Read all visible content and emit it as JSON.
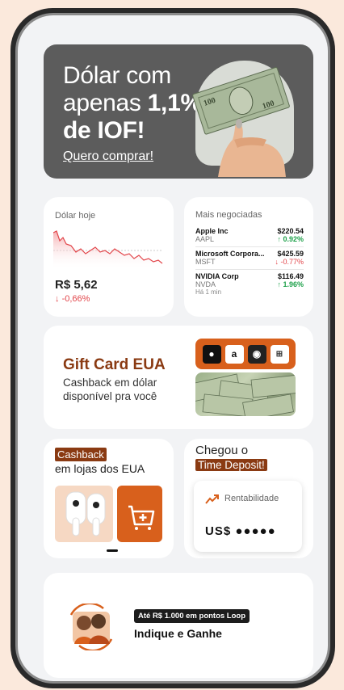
{
  "banner": {
    "line1": "Dólar com",
    "line2_prefix": "apenas ",
    "line2_bold": "1,1%",
    "line3": "de IOF!",
    "link": "Quero comprar!"
  },
  "dolar": {
    "title": "Dólar hoje",
    "price": "R$ 5,62",
    "change": "-0,66%"
  },
  "stocks": {
    "title": "Mais negociadas",
    "items": [
      {
        "name": "Apple Inc",
        "price": "$220.54",
        "ticker": "AAPL",
        "change": "0.92%",
        "direction": "up"
      },
      {
        "name": "Microsoft Corpora...",
        "price": "$425.59",
        "ticker": "MSFT",
        "change": "-0.77%",
        "direction": "down"
      },
      {
        "name": "NVIDIA Corp",
        "price": "$116.49",
        "ticker": "NVDA",
        "change": "1.96%",
        "direction": "up"
      }
    ],
    "updated": "Há 1 min"
  },
  "gift": {
    "title": "Gift Card EUA",
    "subtitle": "Cashback em dólar disponível pra você"
  },
  "cashback": {
    "tag": "Cashback",
    "subtitle": "em lojas dos EUA"
  },
  "time_deposit": {
    "line1": "Chegou o",
    "tag": "Time Deposit!",
    "label": "Rentabilidade",
    "value": "US$ ●●●●●"
  },
  "refer": {
    "badge": "Até R$ 1.000 em pontos Loop",
    "title": "Indique e Ganhe"
  },
  "colors": {
    "brand_orange": "#d8601c",
    "brand_brown": "#8a3a12",
    "positive": "#1fa14b",
    "negative": "#e2454a"
  }
}
